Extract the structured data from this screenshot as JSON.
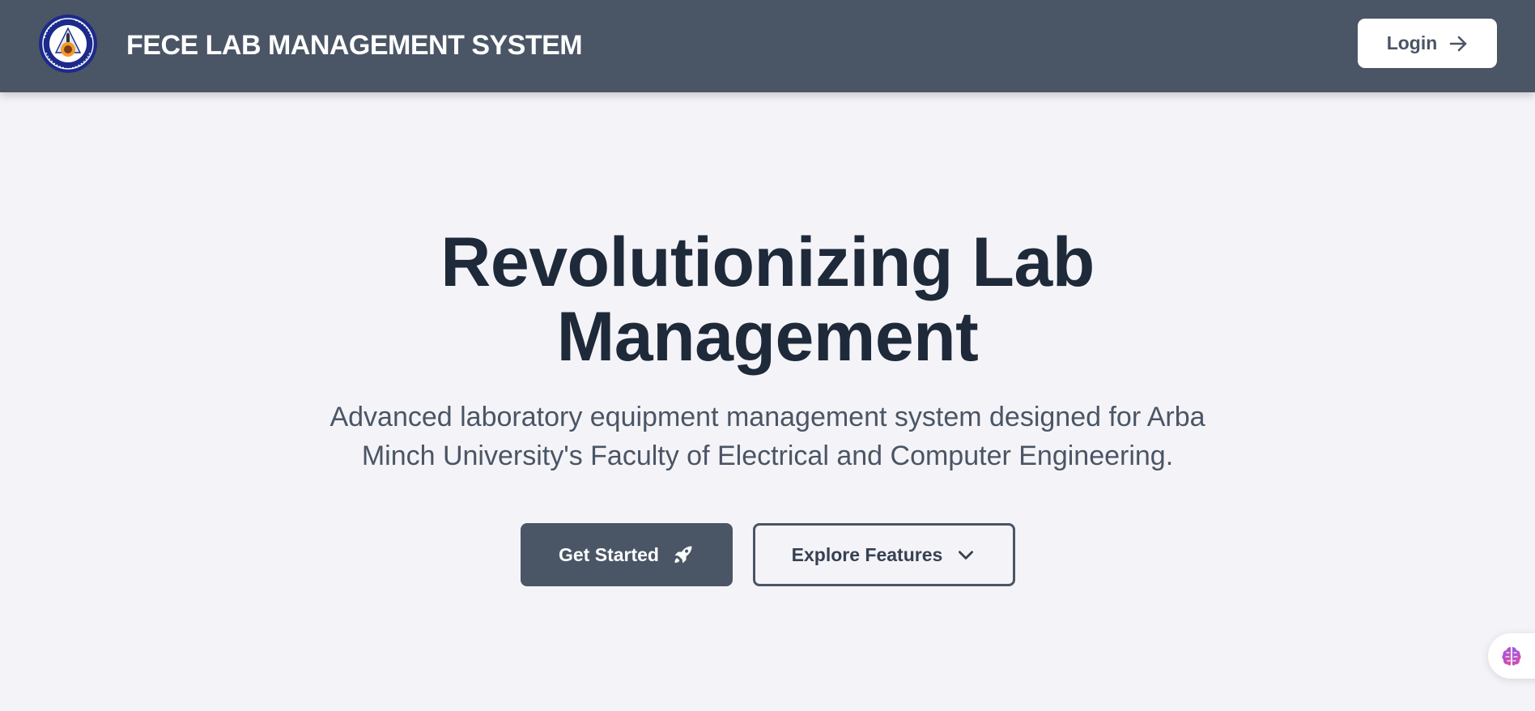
{
  "header": {
    "brand": "FECE LAB MANAGEMENT SYSTEM",
    "logo_icon": "university-seal-icon",
    "login_label": "Login",
    "login_icon": "arrow-right-icon"
  },
  "hero": {
    "title_line1": "Revolutionizing Lab",
    "title_line2": "Management",
    "subtitle_line1": "Advanced laboratory equipment management system designed for Arba",
    "subtitle_line2": "Minch University's Faculty of Electrical and Computer Engineering."
  },
  "actions": {
    "get_started_label": "Get Started",
    "get_started_icon": "rocket-icon",
    "explore_label": "Explore Features",
    "explore_icon": "chevron-down-icon"
  },
  "assistant": {
    "icon": "brain-icon"
  },
  "colors": {
    "navbar": "#4a5565",
    "background": "#f4f4f8",
    "heading": "#1e2939",
    "body_text": "#4a5565",
    "white": "#ffffff"
  }
}
